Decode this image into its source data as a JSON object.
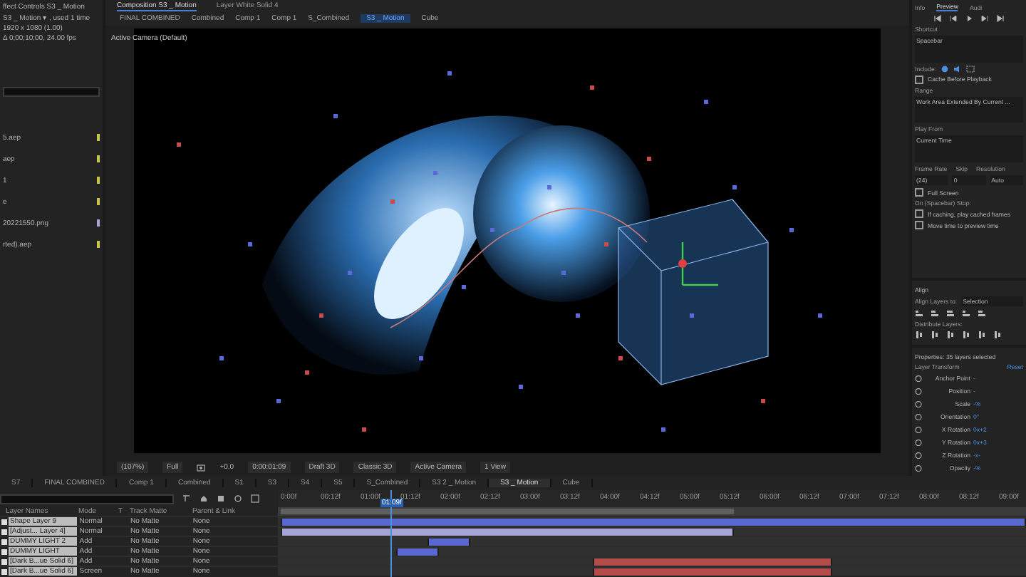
{
  "project_panel": {
    "title": "ffect Controls S3 _ Motion",
    "comp_name": "S3 _ Motion ▾ , used 1 time",
    "comp_size": "1920 x 1080 (1.00)",
    "comp_duration": "Δ 0;00;10;00, 24.00 fps",
    "items": [
      {
        "name": "5.aep",
        "color": "#c9c54a"
      },
      {
        "name": "aep",
        "color": "#c9c54a"
      },
      {
        "name": "1",
        "color": "#c9c54a"
      },
      {
        "name": "e",
        "color": "#c9c54a"
      },
      {
        "name": "20221550.png",
        "color": "#a9a3d6"
      },
      {
        "name": "rted).aep",
        "color": "#c9c54a"
      }
    ]
  },
  "viewer": {
    "tabs": [
      {
        "label": "Composition S3 _ Motion",
        "selected": true
      },
      {
        "label": "Layer White Solid 4",
        "selected": false
      }
    ],
    "breadcrumb": [
      {
        "label": "FINAL COMBINED",
        "selected": false
      },
      {
        "label": "Combined",
        "selected": false
      },
      {
        "label": "Comp 1",
        "selected": false
      },
      {
        "label": "Comp 1",
        "selected": false
      },
      {
        "label": "S_Combined",
        "selected": false
      },
      {
        "label": "S3 _ Motion",
        "selected": true
      },
      {
        "label": "Cube",
        "selected": false
      }
    ],
    "camera_label": "Active Camera (Default)",
    "toolbar": {
      "zoom": "(107%)",
      "resolution": "Full",
      "exposure": "+0.0",
      "timecode": "0:00:01:09",
      "draft": "Draft 3D",
      "renderer": "Classic 3D",
      "camera": "Active Camera",
      "views": "1 View"
    }
  },
  "preview_panel": {
    "tabs": [
      {
        "label": "Info",
        "selected": false
      },
      {
        "label": "Preview",
        "selected": true
      },
      {
        "label": "Audi",
        "selected": false
      }
    ],
    "shortcut_label": "Shortcut",
    "shortcut": "Spacebar",
    "include_label": "Include:",
    "cache_before": {
      "label": "Cache Before Playback",
      "checked": false
    },
    "range_label": "Range",
    "range": "Work Area Extended By Current ...",
    "play_from_label": "Play From",
    "play_from": "Current Time",
    "frame_rate_label": "Frame Rate",
    "skip_label": "Skip",
    "resolution_label": "Resolution",
    "frame_rate": "(24)",
    "skip": "0",
    "resolution": "Auto",
    "full_screen": {
      "label": "Full Screen",
      "checked": false
    },
    "stop_label": "On (Spacebar) Stop:",
    "stop_options": [
      {
        "label": "If caching, play cached frames",
        "checked": false
      },
      {
        "label": "Move time to preview time",
        "checked": false
      }
    ]
  },
  "align_panel": {
    "title": "Align",
    "align_to_label": "Align Layers to:",
    "align_to": "Selection",
    "distribute_label": "Distribute Layers:"
  },
  "properties_panel": {
    "title": "Properties: 35 layers selected",
    "section": "Layer Transform",
    "reset": "Reset",
    "properties": [
      {
        "name": "Anchor Point",
        "value": "-"
      },
      {
        "name": "Position",
        "value": "-"
      },
      {
        "name": "Scale",
        "value": "-%"
      },
      {
        "name": "Orientation",
        "value": "0°"
      },
      {
        "name": "X Rotation",
        "value": "0x+2"
      },
      {
        "name": "Y Rotation",
        "value": "0x+3"
      },
      {
        "name": "Z Rotation",
        "value": "-x-"
      },
      {
        "name": "Opacity",
        "value": "-%"
      }
    ]
  },
  "timeline": {
    "tabs": [
      {
        "label": "S7",
        "selected": false
      },
      {
        "label": "FINAL COMBINED",
        "selected": false
      },
      {
        "label": "Comp 1",
        "selected": false
      },
      {
        "label": "Combined",
        "selected": false
      },
      {
        "label": "S1",
        "selected": false
      },
      {
        "label": "S3",
        "selected": false
      },
      {
        "label": "S4",
        "selected": false
      },
      {
        "label": "S5",
        "selected": false
      },
      {
        "label": "S_Combined",
        "selected": false
      },
      {
        "label": "S3 2 _ Motion",
        "selected": false
      },
      {
        "label": "S3 _ Motion",
        "selected": true
      },
      {
        "label": "Cube",
        "selected": false
      }
    ],
    "columns": [
      "Layer Names",
      "Mode",
      "T",
      "Track Matte",
      "Parent & Link"
    ],
    "ruler": [
      "0:00f",
      "00:12f",
      "01:00f",
      "01:12f",
      "02:00f",
      "02:12f",
      "03:00f",
      "03:12f",
      "04:00f",
      "04:12f",
      "05:00f",
      "05:12f",
      "06:00f",
      "06:12f",
      "07:00f",
      "07:12f",
      "08:00f",
      "08:12f",
      "09:00f"
    ],
    "playhead": "01:09f",
    "work_area": {
      "level": 0.61
    },
    "layers": [
      {
        "name": "Shape Layer 9",
        "mode": "Normal",
        "matte": "No Matte",
        "parent": "None",
        "color": "#5a68d2",
        "in_point": {
          "level": 0.004
        },
        "out_point": {
          "level": 1
        }
      },
      {
        "name": "[Adjust... Layer 4]",
        "mode": "Normal",
        "matte": "No Matte",
        "parent": "None",
        "color": "#a6a4d6",
        "in_point": {
          "level": 0.004
        },
        "out_point": {
          "level": 0.61
        }
      },
      {
        "name": "DUMMY LIGHT 2",
        "mode": "Add",
        "matte": "No Matte",
        "parent": "None",
        "color": "#5a68d2",
        "in_point": {
          "level": 0.2
        },
        "out_point": {
          "level": 0.257
        }
      },
      {
        "name": "DUMMY LIGHT",
        "mode": "Add",
        "matte": "No Matte",
        "parent": "None",
        "color": "#5a68d2",
        "in_point": {
          "level": 0.158
        },
        "out_point": {
          "level": 0.215
        }
      },
      {
        "name": "[Dark B...ue Solid 6]",
        "mode": "Add",
        "matte": "No Matte",
        "parent": "None",
        "color": "#b44c4c",
        "in_point": {
          "level": 0.42
        },
        "out_point": {
          "level": 0.74
        }
      },
      {
        "name": "[Dark B...ue Solid 6]",
        "mode": "Screen",
        "matte": "No Matte",
        "parent": "None",
        "color": "#b44c4c",
        "in_point": {
          "level": 0.42
        },
        "out_point": {
          "level": 0.74
        }
      }
    ]
  }
}
